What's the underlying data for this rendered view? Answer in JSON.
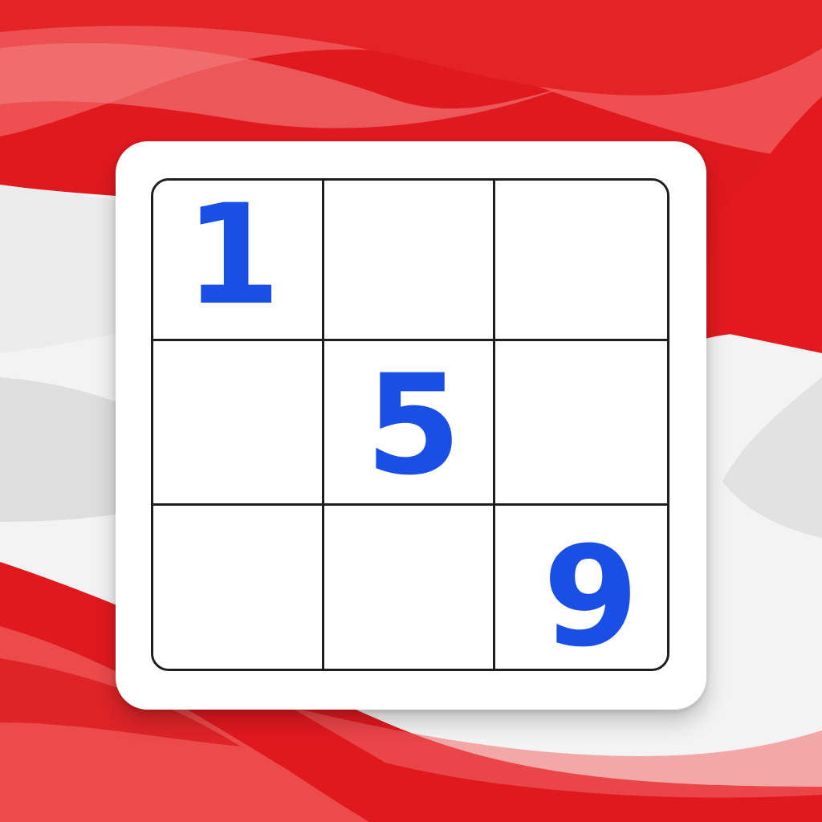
{
  "colors": {
    "background_red": "#e0191f",
    "background_light_red": "#f05b5b",
    "background_white": "#f7f7f7",
    "card": "#ffffff",
    "grid_line": "#1e1e1e",
    "digit": "#1a4fe6"
  },
  "board": {
    "size": 3,
    "cells": [
      [
        "1",
        "",
        ""
      ],
      [
        "",
        "5",
        ""
      ],
      [
        "",
        "",
        "9"
      ]
    ]
  }
}
